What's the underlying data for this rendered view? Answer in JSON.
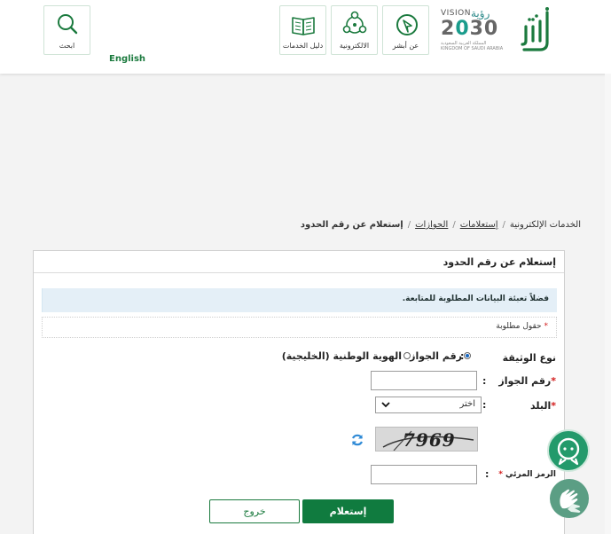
{
  "header": {
    "lang_link": "English",
    "nav": [
      {
        "label": "عن أبشر",
        "icon": "absher-cursor-icon"
      },
      {
        "label": "الالكترونية",
        "icon": "eservices-network-icon"
      },
      {
        "label": "دليل الخدمات",
        "icon": "services-guide-book-icon"
      },
      {
        "label": "ابحث",
        "icon": "search-icon"
      }
    ],
    "vision": {
      "word": "VISION",
      "ar": "رؤية",
      "year_a": "2",
      "year_b": "0",
      "year_c": "30",
      "sub": "المملكة العربية السعودية KINGDOM OF SAUDI ARABIA"
    },
    "colors": {
      "primary": "#107b3f",
      "accent": "#1a9c8c"
    }
  },
  "breadcrumb": [
    {
      "label": "الخدمات الإلكترونية",
      "link": false
    },
    {
      "label": "إستعلامات",
      "link": true
    },
    {
      "label": "الجوازات",
      "link": true
    },
    {
      "label": "إستعلام عن رقم الحدود",
      "link": false
    }
  ],
  "form": {
    "title": "إستعلام عن رقم الحدود",
    "info": "فضلاً تعبئة البيانات المطلوبة للمتابعة.",
    "required_note": "حقول مطلوبة",
    "doc_type_label": "نوع الوثيقة",
    "doc_options": [
      {
        "label": "رقم الجواز",
        "checked": true
      },
      {
        "label": "الهوية الوطنية (الخليجية)",
        "checked": false
      }
    ],
    "passport_label": "رقم الجواز",
    "passport_value": "",
    "country_label": "البلد",
    "country_value": "اختر",
    "captcha_text": "7969",
    "code_label": "الرمز المرئي",
    "code_value": "",
    "submit_label": "إستعلام",
    "exit_label": "خروج"
  }
}
